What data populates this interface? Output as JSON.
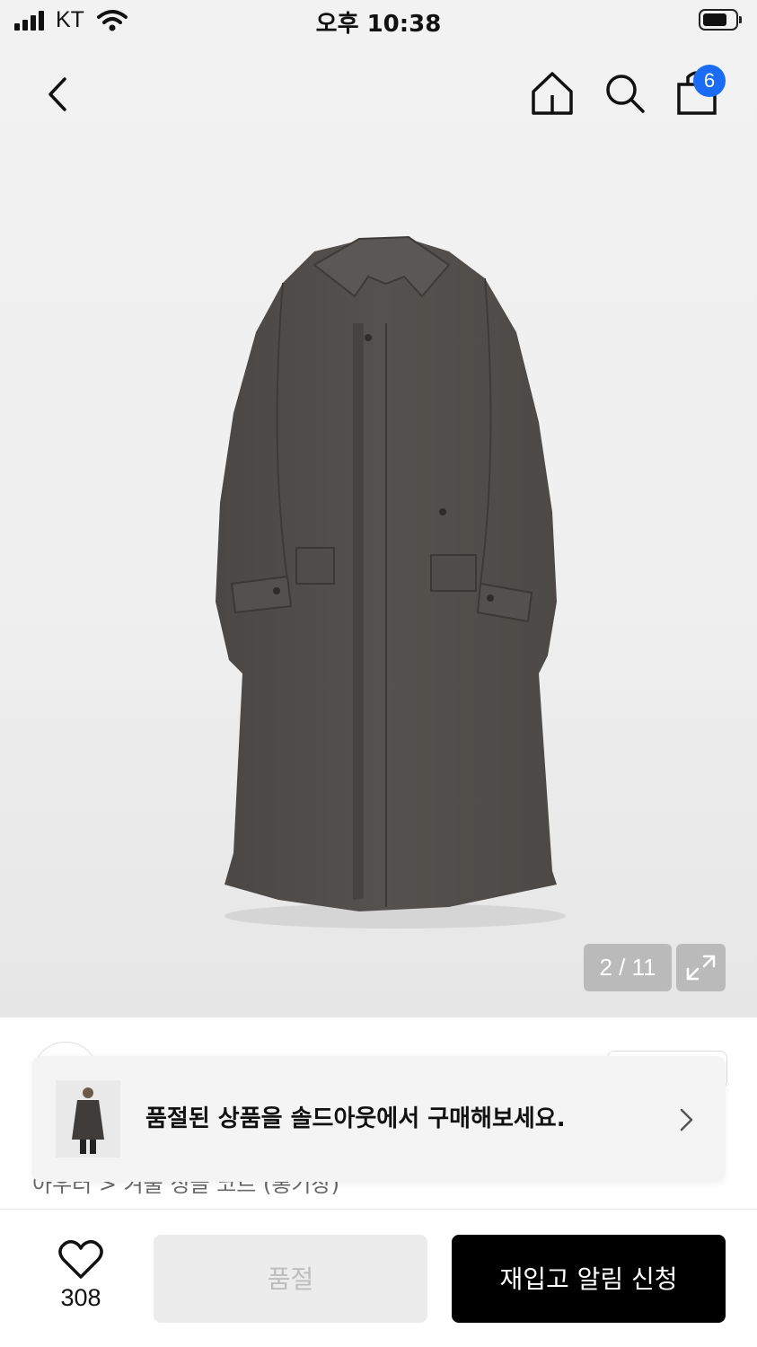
{
  "status_bar": {
    "carrier": "KT",
    "time": "오후 10:38"
  },
  "nav": {
    "cart_count": "6",
    "icons": [
      "back-icon",
      "home-icon",
      "search-icon",
      "shopping-bag-icon"
    ]
  },
  "gallery": {
    "counter": "2 / 11",
    "icons": [
      "expand-icon"
    ]
  },
  "breadcrumb": {
    "text": "아우터 > 겨울 싱글 코트 (롱기장)"
  },
  "banner": {
    "message": "품절된 상품을 솔드아웃에서 구매해보세요.",
    "icons": [
      "chevron-right-icon"
    ]
  },
  "bottom_bar": {
    "like_count": "308",
    "soldout_label": "품절",
    "notify_label": "재입고 알림 신청",
    "icons": [
      "heart-icon"
    ]
  },
  "colors": {
    "badge": "#1a6cf5",
    "notify_button": "#000000",
    "soldout_button": "#ececec"
  }
}
